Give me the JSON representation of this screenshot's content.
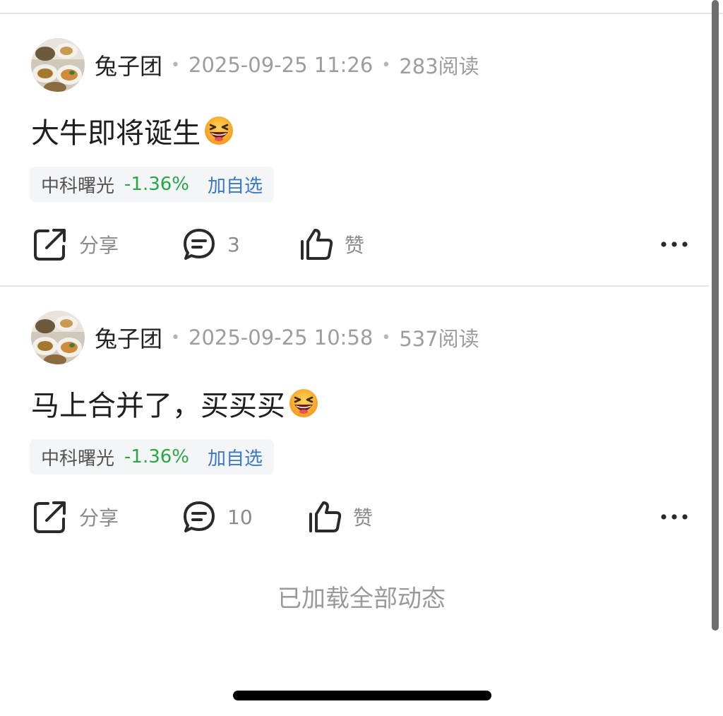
{
  "feed": {
    "posts": [
      {
        "username": "兔子团",
        "timestamp": "2025-09-25 11:26",
        "views": "283阅读",
        "text": "大牛即将诞生",
        "emoji": "grinning-squinting-face-emoji",
        "stock": {
          "name": "中科曙光",
          "change": "-1.36%",
          "watch_label": "加自选"
        },
        "actions": {
          "share_label": "分享",
          "comment_count": "3",
          "like_label": "赞"
        }
      },
      {
        "username": "兔子团",
        "timestamp": "2025-09-25 10:58",
        "views": "537阅读",
        "text": "马上合并了，买买买",
        "emoji": "grinning-squinting-face-emoji",
        "stock": {
          "name": "中科曙光",
          "change": "-1.36%",
          "watch_label": "加自选"
        },
        "actions": {
          "share_label": "分享",
          "comment_count": "10",
          "like_label": "赞"
        }
      }
    ],
    "load_status": "已加载全部动态"
  },
  "colors": {
    "stock_down": "#27a844",
    "link_blue": "#3b78c5",
    "meta_gray": "#9d9d9d"
  }
}
